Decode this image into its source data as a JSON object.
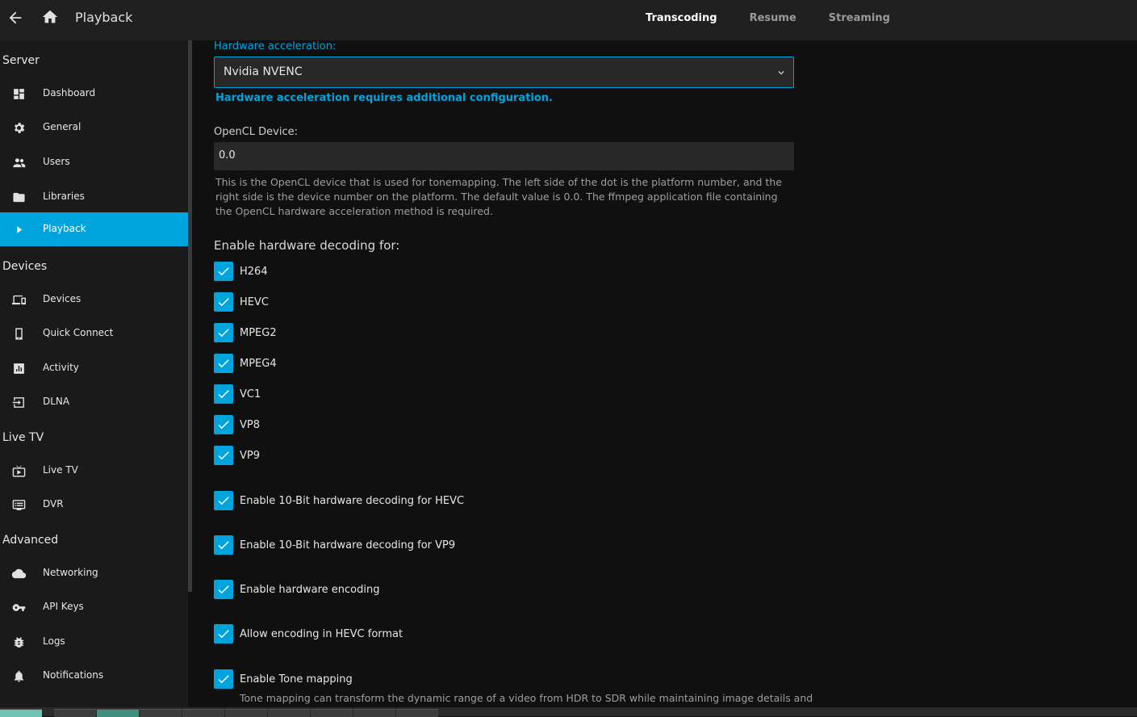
{
  "header": {
    "title": "Playback",
    "tabs": [
      {
        "label": "Transcoding",
        "active": true
      },
      {
        "label": "Resume",
        "active": false
      },
      {
        "label": "Streaming",
        "active": false
      }
    ]
  },
  "sidebar": {
    "sections": [
      {
        "title": "Server",
        "items": [
          {
            "label": "Dashboard",
            "icon": "dashboard-icon"
          },
          {
            "label": "General",
            "icon": "gear-icon"
          },
          {
            "label": "Users",
            "icon": "users-icon"
          },
          {
            "label": "Libraries",
            "icon": "folder-icon"
          },
          {
            "label": "Playback",
            "icon": "play-icon",
            "active": true
          }
        ]
      },
      {
        "title": "Devices",
        "items": [
          {
            "label": "Devices",
            "icon": "devices-icon"
          },
          {
            "label": "Quick Connect",
            "icon": "cast-icon"
          },
          {
            "label": "Activity",
            "icon": "chart-icon"
          },
          {
            "label": "DLNA",
            "icon": "input-icon"
          }
        ]
      },
      {
        "title": "Live TV",
        "items": [
          {
            "label": "Live TV",
            "icon": "tv-icon"
          },
          {
            "label": "DVR",
            "icon": "dvr-icon"
          }
        ]
      },
      {
        "title": "Advanced",
        "items": [
          {
            "label": "Networking",
            "icon": "cloud-icon"
          },
          {
            "label": "API Keys",
            "icon": "key-icon"
          },
          {
            "label": "Logs",
            "icon": "bug-icon"
          },
          {
            "label": "Notifications",
            "icon": "bell-icon"
          }
        ]
      }
    ]
  },
  "form": {
    "hw_accel_label": "Hardware acceleration:",
    "hw_accel_value": "Nvidia NVENC",
    "hw_accel_warning": "Hardware acceleration requires additional configuration.",
    "opencl_label": "OpenCL Device:",
    "opencl_value": "0.0",
    "opencl_help": "This is the OpenCL device that is used for tonemapping. The left side of the dot is the platform number, and the right side is the device number on the platform. The default value is 0.0. The ffmpeg application file containing the OpenCL hardware acceleration method is required.",
    "decoding_heading": "Enable hardware decoding for:",
    "codecs": [
      {
        "label": "H264",
        "checked": true
      },
      {
        "label": "HEVC",
        "checked": true
      },
      {
        "label": "MPEG2",
        "checked": true
      },
      {
        "label": "MPEG4",
        "checked": true
      },
      {
        "label": "VC1",
        "checked": true
      },
      {
        "label": "VP8",
        "checked": true
      },
      {
        "label": "VP9",
        "checked": true
      }
    ],
    "options": [
      {
        "label": "Enable 10-Bit hardware decoding for HEVC",
        "checked": true
      },
      {
        "label": "Enable 10-Bit hardware decoding for VP9",
        "checked": true
      },
      {
        "label": "Enable hardware encoding",
        "checked": true
      },
      {
        "label": "Allow encoding in HEVC format",
        "checked": true
      },
      {
        "label": "Enable Tone mapping",
        "checked": true
      }
    ],
    "tonemap_help": "Tone mapping can transform the dynamic range of a video from HDR to SDR while maintaining image details and"
  },
  "colors": {
    "accent": "#00a4dc",
    "background": "#101010",
    "sidebar": "#1a1a1a",
    "header": "#202020"
  }
}
